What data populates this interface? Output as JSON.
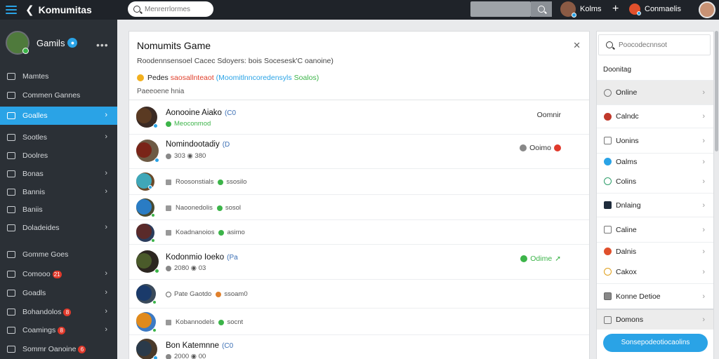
{
  "topbar": {
    "brand": "Komumitas",
    "search_placeholder": "Menrerrlormes",
    "user1_name": "Kolms",
    "user2_name": "Conmaelis"
  },
  "sidebar": {
    "profile_name": "Gamils",
    "profile_badge": "●",
    "menu_glyph": "•••",
    "items": [
      {
        "label": "Mamtes",
        "badge": ""
      },
      {
        "label": "Commen Gannes",
        "badge": ""
      },
      {
        "label": "Goalles",
        "badge": ""
      },
      {
        "label": "Sootles",
        "badge": ""
      },
      {
        "label": "Doolres",
        "badge": ""
      },
      {
        "label": "Bonas",
        "badge": ""
      },
      {
        "label": "Bannis",
        "badge": ""
      },
      {
        "label": "Baniis",
        "badge": ""
      },
      {
        "label": "Doladeides",
        "badge": ""
      },
      {
        "label": "Gomme Goes",
        "badge": ""
      },
      {
        "label": "Comooo",
        "badge": "21"
      },
      {
        "label": "Goadls",
        "badge": ""
      },
      {
        "label": "Bohandolos",
        "badge": "8"
      },
      {
        "label": "Coamings",
        "badge": "8"
      },
      {
        "label": "Sommr Oanoine",
        "badge": "6"
      }
    ]
  },
  "main": {
    "title": "Nomumits Game",
    "close_glyph": "✕",
    "subtitle": "Roodennsensoel Cacec Sdoyers: bois Socesesk'C oanoine)",
    "meta_a": "Pedes",
    "meta_b": "saosallnteaot",
    "meta_c": "(Moomitlnncoredensyls",
    "meta_d": "Soalos)",
    "note": "Paeeoene hnia",
    "rows": [
      {
        "title": "Aonooine Aiako",
        "tag": "(C0",
        "sub": "Meoconmod",
        "right": "Oomnir"
      },
      {
        "title": "Nomindootadiy",
        "tag": "(D",
        "sub": "303 ◉ 380",
        "right": "Ooimo"
      },
      {
        "title": "",
        "tag": "",
        "sub_a": "Roosonstials",
        "sub_b": "ssosilo",
        "right": ""
      },
      {
        "title": "",
        "tag": "",
        "sub_a": "Naoonedolis",
        "sub_b": "sosol",
        "right": ""
      },
      {
        "title": "",
        "tag": "",
        "sub_a": "Koadnanoios",
        "sub_b": "asimo",
        "right": ""
      },
      {
        "title": "Kodonmio Ioeko",
        "tag": "(Pa",
        "sub": "2080 ◉ 03",
        "right": "Odime"
      },
      {
        "title": "",
        "tag": "",
        "sub_a": "Pate Gaotdo",
        "sub_b": "ssoam0",
        "right": ""
      },
      {
        "title": "",
        "tag": "",
        "sub_a": "Kobannodels",
        "sub_b": "socnt",
        "right": ""
      },
      {
        "title": "Bon Katemnne",
        "tag": "(C0",
        "sub": "2000 ◉ 00",
        "right": ""
      }
    ]
  },
  "right_panel": {
    "search_placeholder": "Poocodecnnsot",
    "heading": "Doonitag",
    "items": [
      {
        "label": "Online"
      },
      {
        "label": "Calndc"
      },
      {
        "label": "Uonins"
      },
      {
        "label": "Oalms"
      },
      {
        "label": "Colins"
      },
      {
        "label": "Dnlaing"
      },
      {
        "label": "Caline"
      },
      {
        "label": "Dalnis"
      },
      {
        "label": "Cakox"
      },
      {
        "label": "Konne Detioe"
      },
      {
        "label": "Domons"
      }
    ],
    "button_label": "Sonsepodeotiocaolins"
  },
  "colors": {
    "accent": "#2aa3e6",
    "sidebar": "#2b3036",
    "topbar": "#1f2329",
    "success": "#3cb449",
    "danger": "#e0392b"
  }
}
